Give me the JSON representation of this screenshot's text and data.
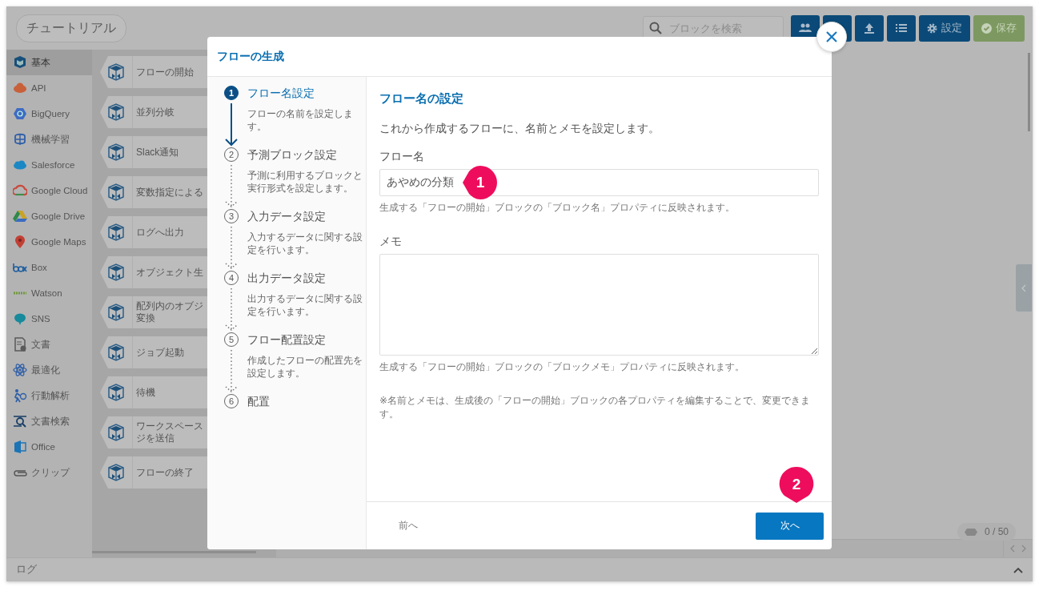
{
  "app": {
    "title": "チュートリアル",
    "search": {
      "placeholder": "ブロックを検索"
    },
    "toolbar": [
      {
        "kind": "users"
      },
      {
        "kind": "blank"
      },
      {
        "kind": "upload"
      },
      {
        "kind": "list"
      },
      {
        "kind": "settings",
        "label": "設定"
      },
      {
        "kind": "save",
        "label": "保存"
      }
    ],
    "categories": [
      {
        "kind": "block",
        "label": "基本",
        "selected": true
      },
      {
        "kind": "api",
        "label": "API",
        "selected": false
      },
      {
        "kind": "bigquery",
        "label": "BigQuery",
        "selected": false
      },
      {
        "kind": "ml",
        "label": "機械学習",
        "selected": false
      },
      {
        "kind": "salesforce",
        "label": "Salesforce",
        "selected": false
      },
      {
        "kind": "gcloud",
        "label": "Google Cloud",
        "selected": false
      },
      {
        "kind": "gdrive",
        "label": "Google Drive",
        "selected": false
      },
      {
        "kind": "gmaps",
        "label": "Google Maps",
        "selected": false
      },
      {
        "kind": "box",
        "label": "Box",
        "selected": false
      },
      {
        "kind": "watson",
        "label": "Watson",
        "selected": false
      },
      {
        "kind": "sns",
        "label": "SNS",
        "selected": false
      },
      {
        "kind": "doc",
        "label": "文書",
        "selected": false
      },
      {
        "kind": "optimize",
        "label": "最適化",
        "selected": false
      },
      {
        "kind": "behavior",
        "label": "行動解析",
        "selected": false
      },
      {
        "kind": "docsearch",
        "label": "文書検索",
        "selected": false
      },
      {
        "kind": "office",
        "label": "Office",
        "selected": false
      },
      {
        "kind": "clip",
        "label": "クリップ",
        "selected": false
      }
    ],
    "blocks": [
      {
        "lines": [
          "フローの開始"
        ]
      },
      {
        "lines": [
          "並列分岐"
        ]
      },
      {
        "lines": [
          "Slack通知"
        ]
      },
      {
        "lines": [
          "変数指定による"
        ]
      },
      {
        "lines": [
          "ログへ出力"
        ]
      },
      {
        "lines": [
          "オブジェクト生"
        ]
      },
      {
        "lines": [
          "配列内のオブジ",
          "変換"
        ]
      },
      {
        "lines": [
          "ジョブ起動"
        ]
      },
      {
        "lines": [
          "待機"
        ]
      },
      {
        "lines": [
          "ワークスペース",
          "ジを送信"
        ]
      },
      {
        "lines": [
          "フローの終了"
        ]
      }
    ],
    "counter": "0 / 50",
    "log": "ログ"
  },
  "modal": {
    "title": "フローの生成",
    "steps": [
      {
        "number": "1",
        "title": "フロー名設定",
        "description": "フローの名前を設定します。",
        "selected": true
      },
      {
        "number": "2",
        "title": "予測ブロック設定",
        "description": "予測に利用するブロックと実行形式を設定します。",
        "selected": false
      },
      {
        "number": "3",
        "title": "入力データ設定",
        "description": "入力するデータに関する設定を行います。",
        "selected": false
      },
      {
        "number": "4",
        "title": "出力データ設定",
        "description": "出力するデータに関する設定を行います。",
        "selected": false
      },
      {
        "number": "5",
        "title": "フロー配置設定",
        "description": "作成したフローの配置先を設定します。",
        "selected": false
      },
      {
        "number": "6",
        "title": "配置",
        "selected": false
      }
    ],
    "heading": "フロー名の設定",
    "intro": "これから作成するフローに、名前とメモを設定します。",
    "fields": [
      {
        "kind": "input",
        "label": "フロー名",
        "value": "あやめの分類",
        "hint": "生成する「フローの開始」ブロックの「ブロック名」プロパティに反映されます。"
      },
      {
        "kind": "textarea",
        "label": "メモ",
        "hint": "生成する「フローの開始」ブロックの「ブロックメモ」プロパティに反映されます。"
      }
    ],
    "note": "※名前とメモは、生成後の「フローの開始」ブロックの各プロパティを編集することで、変更できます。",
    "back": "前へ",
    "next": "次へ",
    "annotations": [
      {
        "label": "1"
      },
      {
        "label": "2"
      }
    ]
  }
}
